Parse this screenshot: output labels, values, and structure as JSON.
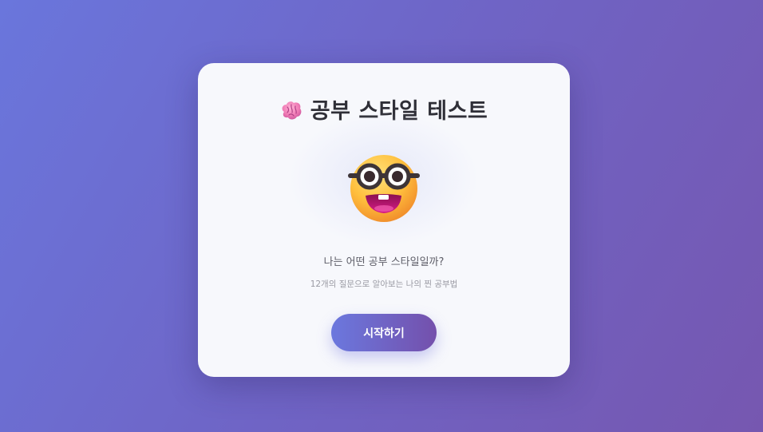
{
  "card": {
    "title": "공부 스타일 테스트",
    "title_icon": "brain-icon",
    "hero_icon": "nerd-face-emoji",
    "subtitle": "나는 어떤 공부 스타일일까?",
    "description": "12개의 질문으로 알아보는 나의 찐 공부법",
    "start_label": "시작하기"
  },
  "colors": {
    "background_start": "#6a76dc",
    "background_end": "#7657b0",
    "card": "#f7f8fc",
    "button_start": "#6b78de",
    "button_end": "#7450ac",
    "title_text": "#2f2f37"
  }
}
